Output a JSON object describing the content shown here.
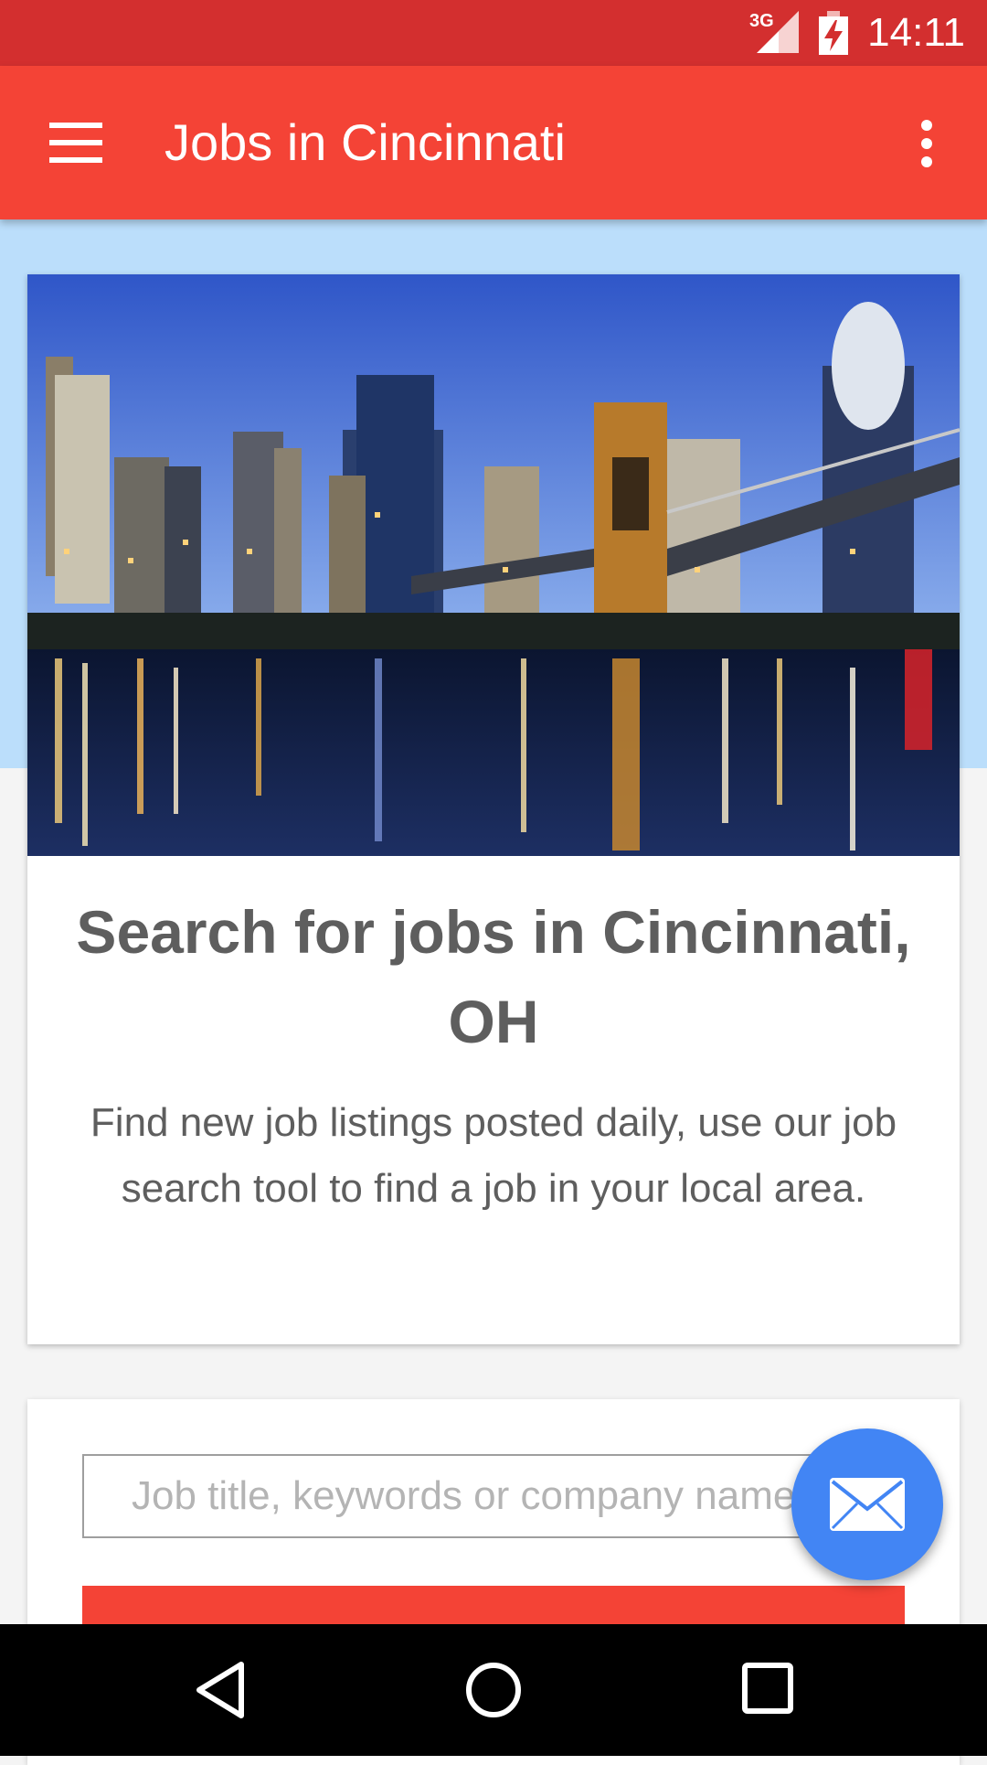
{
  "status_bar": {
    "time": "14:11",
    "network_label": "3G",
    "icons": [
      "signal-icon",
      "battery-charging-icon"
    ]
  },
  "app_bar": {
    "title": "Jobs in Cincinnati",
    "icons": [
      "menu-icon",
      "overflow-menu-icon"
    ]
  },
  "hero": {
    "image": "cincinnati-skyline-photo",
    "heading": "Search for jobs in Cincinnati, OH",
    "text": "Find new job listings posted daily, use our job search tool to find a job in your local area."
  },
  "search": {
    "placeholder": "Job title, keywords or company name",
    "value": "",
    "button_icon": "search-button"
  },
  "fab": {
    "icon": "mail-icon"
  },
  "nav_bar": {
    "icons": [
      "back-icon",
      "home-icon",
      "recents-icon"
    ]
  },
  "colors": {
    "status_bar": "#d32f2f",
    "app_bar": "#f44336",
    "accent_band": "#bbdefb",
    "fab": "#4285f4",
    "text": "#5e5e5e"
  }
}
